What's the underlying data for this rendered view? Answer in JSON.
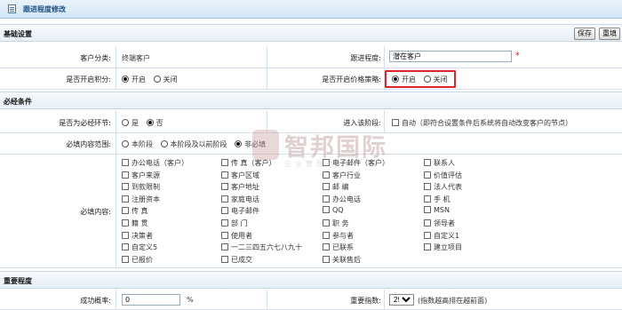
{
  "header": {
    "title": "跟进程度修改"
  },
  "toolbar": {
    "save": "保存",
    "reset": "重填"
  },
  "basic": {
    "section": "基础设置",
    "customer_type_label": "客户分类:",
    "customer_type_value": "终端客户",
    "follow_label": "跟进程度:",
    "follow_value": "潜在客户",
    "required_mark": "*",
    "points_label": "是否开启积分:",
    "price_label": "是否开启价格策略:",
    "on": "开启",
    "off": "关闭"
  },
  "required_conditions": {
    "section": "必经条件",
    "must_label": "是否为必经环节:",
    "yes": "是",
    "no": "否",
    "enter_label": "进入该阶段:",
    "auto_text": "自动（即符合设置条件后系统将自动改变客户的节点）",
    "scope_label": "必填内容范围:",
    "scope_options": [
      "本阶段",
      "本阶段及以前阶段",
      "非必填"
    ],
    "content_label": "必填内容:",
    "columns": [
      [
        "办公电话（客户）",
        "客户来源",
        "到款限制",
        "注册资本",
        "传  真",
        "籍  贯",
        "决策者",
        "自定义5",
        "已报价"
      ],
      [
        "传  真（客户）",
        "客户区域",
        "客户地址",
        "家庭电话",
        "电子邮件",
        "部  门",
        "使用者",
        "一二三四五六七八九十",
        "已成交"
      ],
      [
        "电子邮件（客户）",
        "客户行业",
        "邮  编",
        "办公电话",
        "QQ",
        "职  务",
        "参与者",
        "已联系",
        "关联售后"
      ],
      [
        "联系人",
        "价值评估",
        "法人代表",
        "手  机",
        "MSN",
        "领导者",
        "自定义1",
        "建立项目"
      ]
    ]
  },
  "importance": {
    "section": "重要程度",
    "rate_label": "成功概率:",
    "rate_value": "0",
    "rate_unit": "%",
    "index_label": "重要指数:",
    "index_value": "29",
    "index_hint": "(指数越高排在越前面)"
  },
  "watermark": {
    "title": "智邦国际",
    "subtitle": "企业管理软件"
  },
  "colors": {
    "accent": "#1d4f86",
    "highlight": "#e0242a",
    "section_bg": "#e7eff7"
  }
}
